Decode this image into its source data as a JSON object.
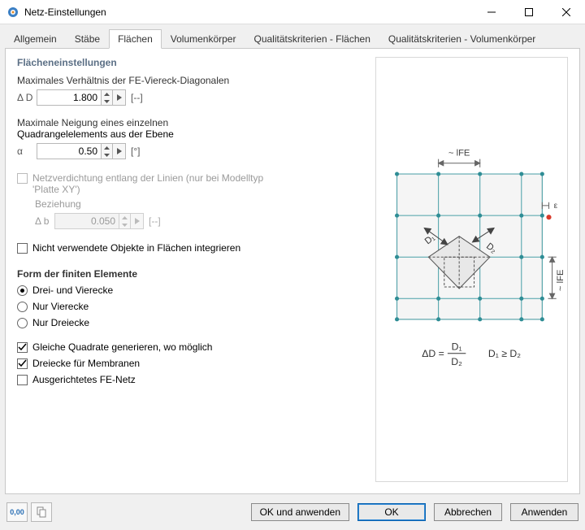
{
  "window": {
    "title": "Netz-Einstellungen"
  },
  "tabs": {
    "t0": "Allgemein",
    "t1": "Stäbe",
    "t2": "Flächen",
    "t3": "Volumenkörper",
    "t4": "Qualitätskriterien - Flächen",
    "t5": "Qualitätskriterien - Volumenkörper"
  },
  "section": {
    "title": "Flächeneinstellungen"
  },
  "diag_ratio": {
    "label": "Maximales Verhältnis der FE-Viereck-Diagonalen",
    "symbol": "Δ D",
    "value": "1.800",
    "unit": "[--]"
  },
  "incline": {
    "label1": "Maximale Neigung eines einzelnen",
    "label2": "Quadrangelelements aus der Ebene",
    "symbol": "α",
    "value": "0.50",
    "unit": "[°]"
  },
  "densify": {
    "label1": "Netzverdichtung entlang der Linien (nur bei Modelltyp",
    "label2": "'Platte XY')",
    "relation_label": "Beziehung",
    "sub_symbol": "Δ b",
    "sub_value": "0.050",
    "sub_unit": "[--]"
  },
  "unused": {
    "label": "Nicht verwendete Objekte in Flächen integrieren"
  },
  "shape": {
    "title": "Form der finiten Elemente",
    "r0": "Drei- und Vierecke",
    "r1": "Nur Vierecke",
    "r2": "Nur Dreiecke"
  },
  "opts": {
    "o0": "Gleiche Quadrate generieren, wo möglich",
    "o1": "Dreiecke für Membranen",
    "o2": "Ausgerichtetes FE-Netz"
  },
  "diagram": {
    "top": "~ lFE",
    "right": "~ lFE",
    "d1": "D₁",
    "d2": "D₂",
    "eps": "ε",
    "formula_left": "ΔD =",
    "formula_num": "D₁",
    "formula_den": "D₂",
    "formula_cond": "D₁ ≥ D₂"
  },
  "buttons": {
    "ok_apply": "OK und anwenden",
    "ok": "OK",
    "cancel": "Abbrechen",
    "apply": "Anwenden"
  },
  "icons": {
    "units": "0,00",
    "copy": ""
  }
}
